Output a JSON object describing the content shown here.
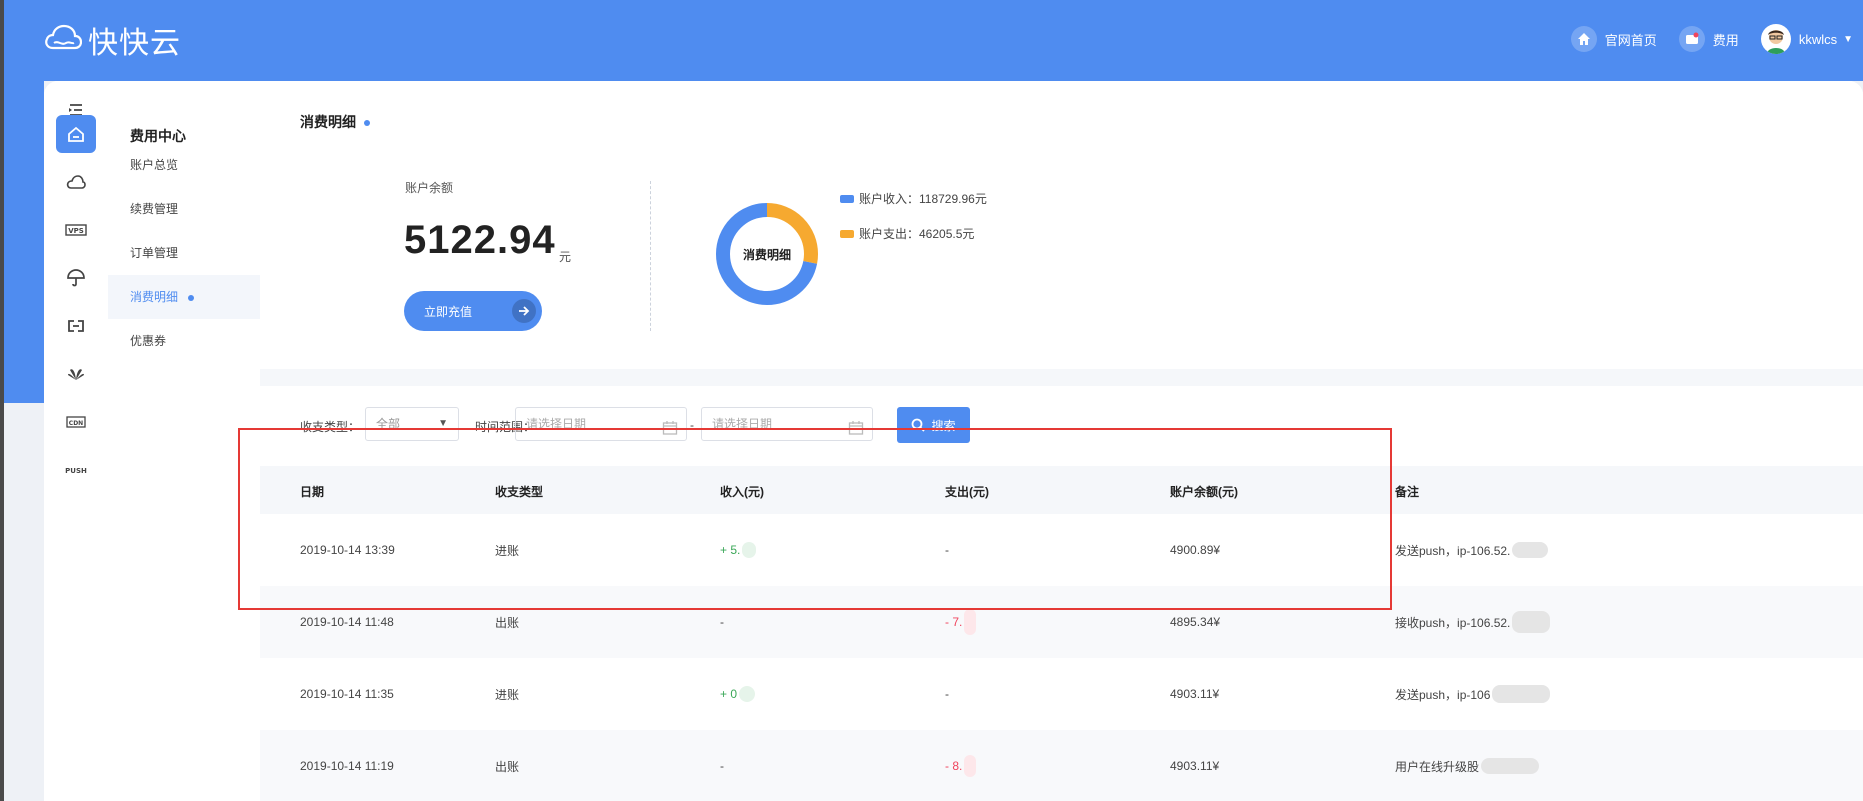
{
  "brand": {
    "name": "快快云"
  },
  "header": {
    "links": [
      {
        "label": "官网首页",
        "icon": "home-icon"
      },
      {
        "label": "费用",
        "icon": "bill-icon"
      }
    ],
    "user": {
      "name": "kkwlcs"
    }
  },
  "rail": {
    "icons": [
      "menu-icon",
      "home-icon",
      "cloud-icon",
      "vps-icon",
      "umbrella-icon",
      "link-icon",
      "huawei-icon",
      "cdn-icon",
      "push-icon"
    ],
    "vps_text": "VPS",
    "cdn_text": "CDN",
    "push_text": "PUSH"
  },
  "submenu": {
    "title": "费用中心",
    "items": [
      "账户总览",
      "续费管理",
      "订单管理",
      "消费明细",
      "优惠券"
    ],
    "active_index": 3
  },
  "summary": {
    "title": "消费明细",
    "balance_label": "账户余额",
    "balance_value": "5122.94",
    "balance_unit": "元",
    "recharge_label": "立即充值",
    "donut_label": "消费明细",
    "income_legend": "账户收入：118729.96元",
    "expense_legend": "账户支出：46205.5元",
    "income_value": 118729.96,
    "expense_value": 46205.5,
    "income_color": "#4f8cf0",
    "expense_color": "#f6a930"
  },
  "filter": {
    "type_label": "收支类型：",
    "type_value": "全部",
    "time_label": "时间范围：",
    "start_placeholder": "请选择日期",
    "end_placeholder": "请选择日期",
    "range_sep": "-",
    "search_label": "搜索"
  },
  "table": {
    "headers": [
      "日期",
      "收支类型",
      "收入(元)",
      "支出(元)",
      "账户余额(元)",
      "备注"
    ],
    "rows": [
      {
        "date": "2019-10-14 13:39",
        "type": "进账",
        "income": "+ 5.",
        "expense": "-",
        "balance": "4900.89¥",
        "note": "发送push，ip-106.52.",
        "income_redact_color": "#e6f4ea",
        "note_redact_color": "#e5e5e5"
      },
      {
        "date": "2019-10-14 11:48",
        "type": "出账",
        "income": "-",
        "expense": "- 7.",
        "balance": "4895.34¥",
        "note": "接收push，ip-106.52.",
        "expense_redact_color": "#fde7ea",
        "note_redact_color": "#e5e5e5"
      },
      {
        "date": "2019-10-14 11:35",
        "type": "进账",
        "income": "+ 0",
        "expense": "-",
        "balance": "4903.11¥",
        "note": "发送push，ip-106",
        "income_redact_color": "#e6f4ea",
        "note_redact_color": "#e5e5e5"
      },
      {
        "date": "2019-10-14 11:19",
        "type": "出账",
        "income": "-",
        "expense": "- 8.",
        "balance": "4903.11¥",
        "note": "用户在线升级股",
        "expense_redact_color": "#fde7ea",
        "note_redact_color": "#e5e5e5"
      }
    ]
  },
  "highlight_color": "#e53935"
}
